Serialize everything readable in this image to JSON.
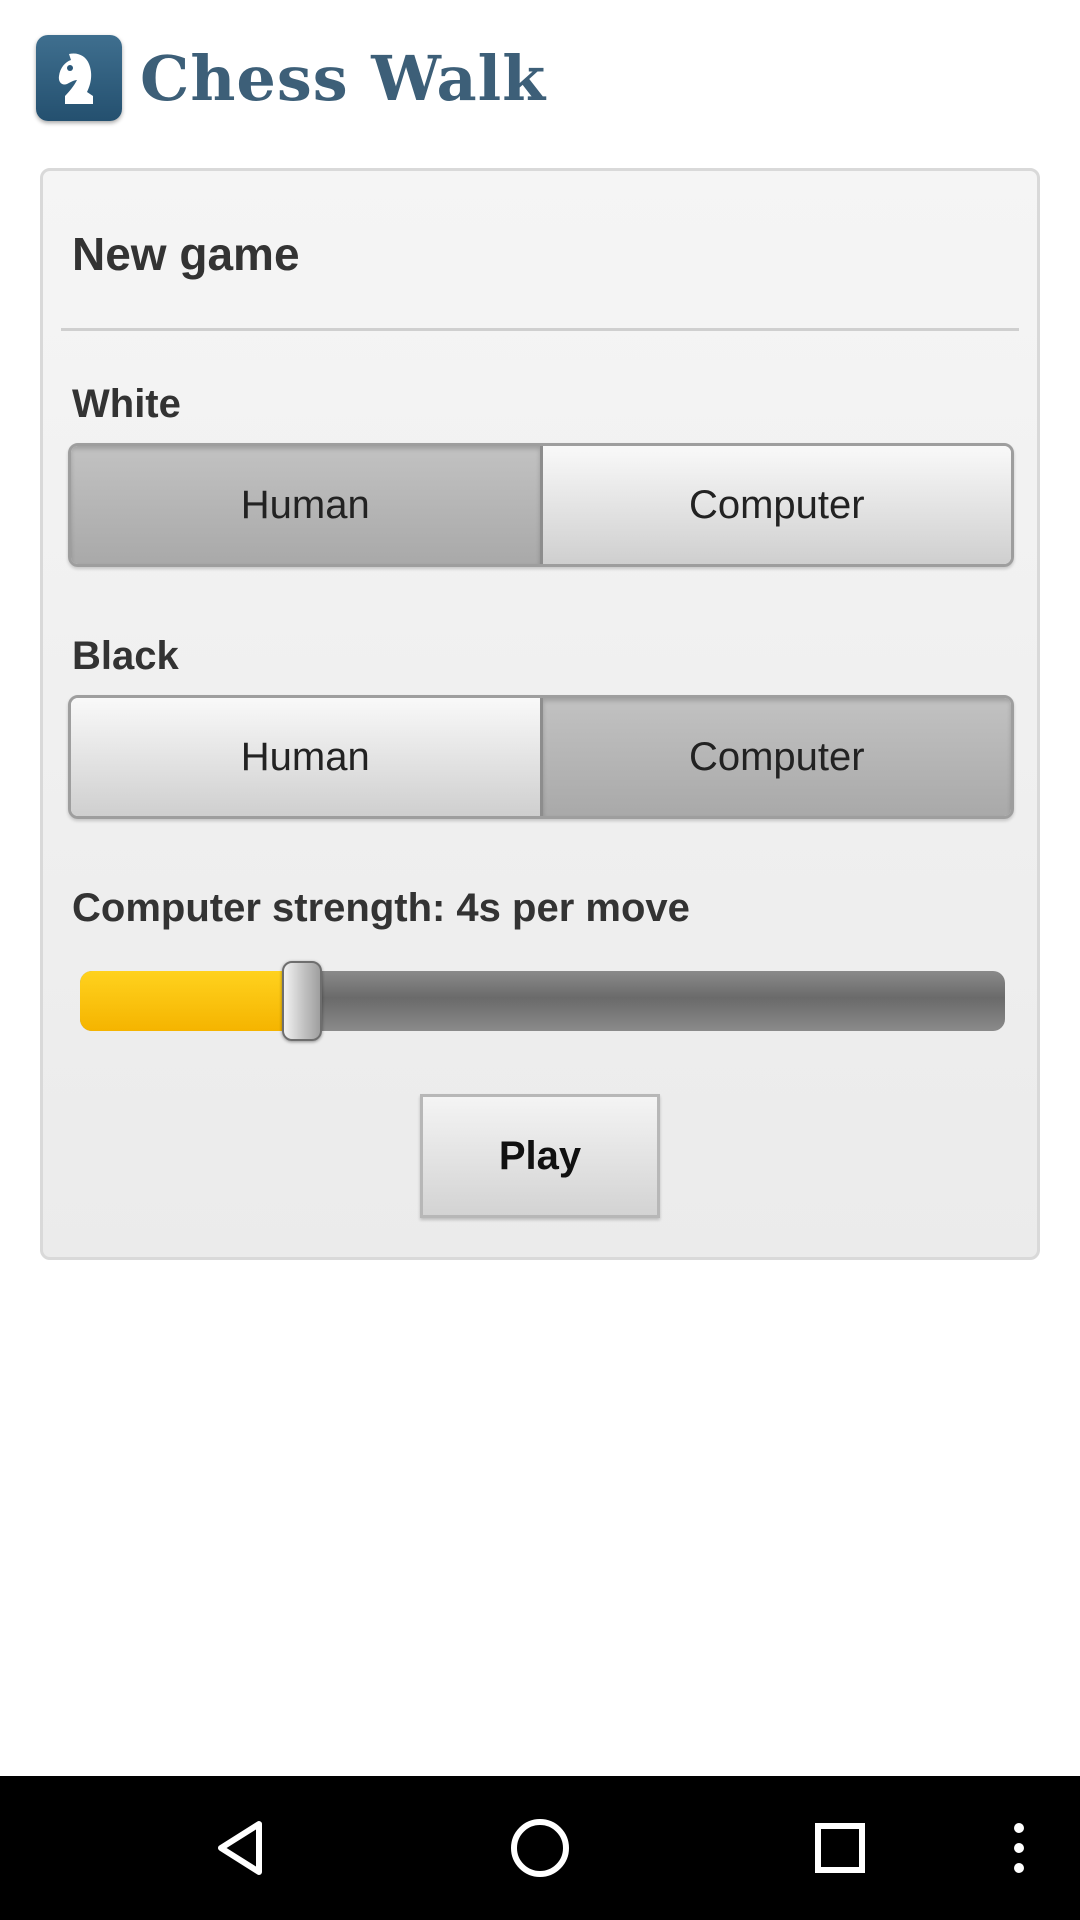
{
  "app": {
    "title": "Chess Walk",
    "logo_icon": "knight-icon",
    "brand_color": "#3d5f78"
  },
  "new_game": {
    "title": "New game",
    "white": {
      "label": "White",
      "options": [
        "Human",
        "Computer"
      ],
      "selected": "Human"
    },
    "black": {
      "label": "Black",
      "options": [
        "Human",
        "Computer"
      ],
      "selected": "Computer"
    },
    "strength": {
      "label": "Computer strength: 4s per move",
      "slider_level_fraction": 0.24,
      "fill_color": "#f5b400"
    },
    "play_label": "Play"
  },
  "navbar": {
    "items": [
      "back-icon",
      "home-icon",
      "recents-icon",
      "overflow-menu-icon"
    ]
  }
}
